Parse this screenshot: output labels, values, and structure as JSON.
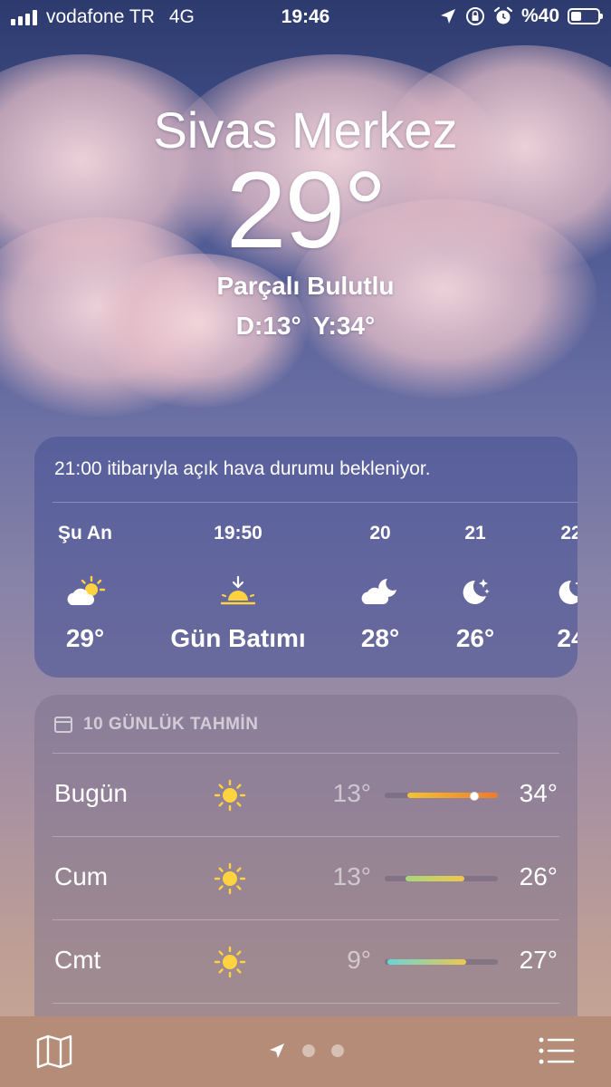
{
  "status_bar": {
    "carrier": "vodafone TR",
    "network": "4G",
    "time": "19:46",
    "battery_text": "%40",
    "battery_level": 0.4,
    "icons": [
      "signal-icon",
      "location-arrow-icon",
      "orientation-lock-icon",
      "alarm-icon",
      "battery-icon"
    ]
  },
  "header": {
    "city": "Sivas Merkez",
    "temperature": "29°",
    "condition": "Parçalı Bulutlu",
    "hilo": "D:13°  Y:34°"
  },
  "hourly": {
    "note": "21:00 itibarıyla açık hava durumu bekleniyor.",
    "items": [
      {
        "label": "Şu An",
        "icon": "partly-sunny-icon",
        "temp": "29°"
      },
      {
        "label": "19:50",
        "icon": "sunset-icon",
        "temp": "Gün Batımı"
      },
      {
        "label": "20",
        "icon": "cloud-moon-icon",
        "temp": "28°"
      },
      {
        "label": "21",
        "icon": "moon-stars-icon",
        "temp": "26°"
      },
      {
        "label": "22",
        "icon": "moon-stars-icon",
        "temp": "24"
      }
    ]
  },
  "daily": {
    "title": "10 GÜNLÜK TAHMİN",
    "days": [
      {
        "day": "Bugün",
        "icon": "sun-icon",
        "low": "13°",
        "high": "34°",
        "range_start": 0.2,
        "range_end": 1.0,
        "current": 0.78,
        "colors": [
          "#f2c236",
          "#f07a2c"
        ]
      },
      {
        "day": "Cum",
        "icon": "sun-icon",
        "low": "13°",
        "high": "26°",
        "range_start": 0.18,
        "range_end": 0.7,
        "colors": [
          "#a8d87a",
          "#f0c84a"
        ]
      },
      {
        "day": "Cmt",
        "icon": "sun-icon",
        "low": "9°",
        "high": "27°",
        "range_start": 0.02,
        "range_end": 0.72,
        "colors": [
          "#66d6d6",
          "#f0c84a"
        ]
      }
    ]
  },
  "toolbar": {
    "pages": 2,
    "icons": [
      "map-icon",
      "location-arrow-icon",
      "page-dot",
      "list-icon"
    ]
  },
  "colors": {
    "sun_yellow": "#ffd23f",
    "toolbar_bg": "#b48c77"
  }
}
